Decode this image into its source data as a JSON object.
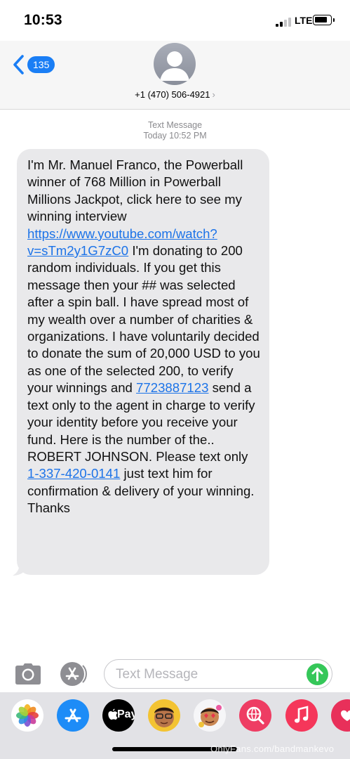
{
  "status_bar": {
    "time": "10:53",
    "network": "LTE"
  },
  "header": {
    "back_count": "135",
    "contact": "+1 (470) 506-4921",
    "contact_chevron": "›"
  },
  "thread": {
    "message_type": "Text Message",
    "timestamp": "Today 10:52 PM"
  },
  "message": {
    "part1": "I'm Mr. Manuel Franco, the Powerball winner of  768 Million in Powerball Millions Jackpot, click here to see my winning interview ",
    "link_youtube": "https://www.youtube.com/watch?v=sTm2y1G7zC0",
    "part2": "  I'm donating to 200 random individuals. If you get this message then your ## was selected after a spin ball. I have spread most of my wealth over a number of charities & organizations. I have voluntarily decided to donate the sum of 20,000 USD to you as one of the selected 200, to verify your winnings and ",
    "link_phone1": "7723887123",
    "part3": " send a text only to the agent in charge to verify your identity before you receive your fund. Here is the number of the.. ROBERT JOHNSON. Please text only ",
    "link_phone2": "1-337-420-0141",
    "part4": " just text him for confirmation & delivery of your winning. Thanks"
  },
  "composer": {
    "placeholder": "Text Message"
  },
  "app_drawer": {
    "apple_pay_label": "Pay"
  },
  "watermark": "OnlyFans.com/bandmankevo",
  "colors": {
    "link": "#1c73e8",
    "badge": "#1a7ef5",
    "send": "#35c759",
    "bubble": "#e9e9eb"
  }
}
